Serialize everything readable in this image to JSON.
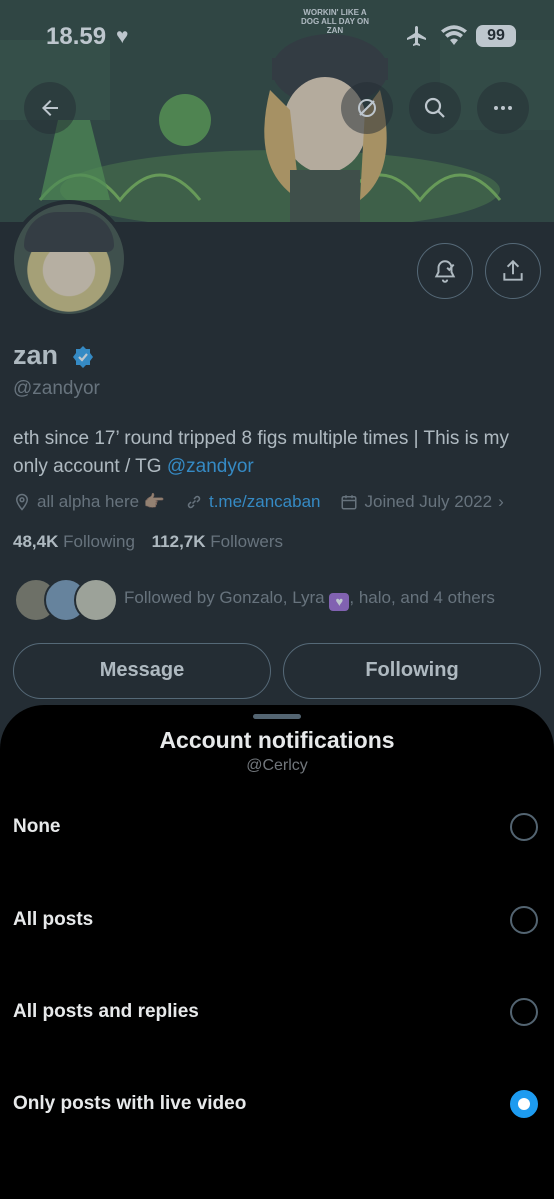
{
  "status": {
    "time": "18.59",
    "battery": "99"
  },
  "banner_cap_text": "WORKIN' LIKE A DOG ALL DAY ON ZAN",
  "profile": {
    "name": "zan",
    "handle": "@zandyor",
    "bio_text": "eth since 17’ round tripped 8 figs multiple times | This is my only account / TG ",
    "bio_link": "@zandyor",
    "location": "all alpha here 👉🏽",
    "website": "t.me/zancaban",
    "joined": "Joined July 2022",
    "following_count": "48,4K",
    "following_label": "Following",
    "followers_count": "112,7K",
    "followers_label": "Followers",
    "followed_by_prefix": "Followed by Gonzalo, Lyra ",
    "followed_by_suffix": ", halo, and 4 others",
    "message_label": "Message",
    "following_button_label": "Following"
  },
  "colors": {
    "accent": "#1d9bf0",
    "muted": "#71767b",
    "text": "#e7e9ea"
  },
  "sheet": {
    "title": "Account notifications",
    "subtitle": "@Cerlcy",
    "options": [
      {
        "label": "None",
        "selected": false
      },
      {
        "label": "All posts",
        "selected": false
      },
      {
        "label": "All posts and replies",
        "selected": false
      },
      {
        "label": "Only posts with live video",
        "selected": true
      }
    ]
  }
}
